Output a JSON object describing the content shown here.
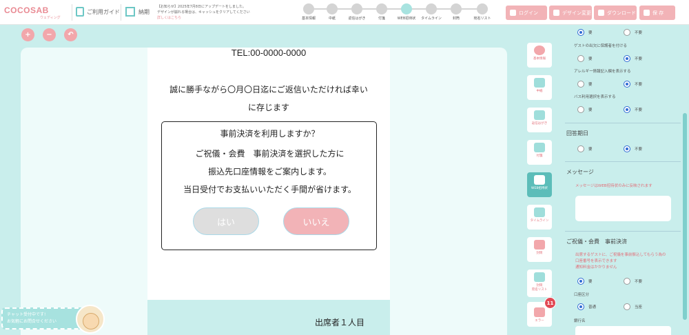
{
  "header": {
    "logo_text": "COCOSAB",
    "logo_sub": "ウェディング",
    "guide_label": "ご利用ガイド",
    "deadline_label": "納期",
    "notice_line1": "【お知らせ】2025年7月8日にアップデートをしました。",
    "notice_line2": "デザインが崩れる場合は、キャッシュをクリアしてください",
    "notice_link": "詳しくはこちら",
    "steps": [
      "基本情報",
      "中紙",
      "返信はがき",
      "付箋",
      "WEB招待状",
      "タイムライン",
      "封筒",
      "宛名リスト"
    ],
    "active_step_index": 4,
    "buttons": {
      "login": "ログイン",
      "change_design": "デザイン変更",
      "download": "ダウンロード",
      "save": "保 存"
    }
  },
  "tools": {
    "zoom_in": "+",
    "zoom_out": "−",
    "back": "↶"
  },
  "card": {
    "tel": "TEL:00-0000-0000",
    "message_line1": "誠に勝手ながら〇月〇日迄にご返信いただければ幸い",
    "message_line2": "に存じます",
    "question": "事前決済を利用しますか？",
    "info_line1": "ご祝儀・会費　事前決済を選択した方に",
    "info_line2": "振込先口座情報をご案内します。",
    "info_line3": "当日受付でお支払いいただく手間が省けます。",
    "yes_label": "はい",
    "no_label": "いいえ",
    "attendees_label": "出席者１人目"
  },
  "chat": {
    "line1": "チャット受付中です!",
    "line2": "お気軽にお問合せください"
  },
  "right_nav": {
    "items": [
      "基本情報",
      "中紙",
      "返信はがき",
      "付箋",
      "WEB招待状",
      "タイムライン",
      "封筒",
      "封筒\n宛名リスト",
      "エラー"
    ],
    "active_index": 4,
    "error_count": "11"
  },
  "panel": {
    "opt_yes": "要",
    "opt_no": "不要",
    "row1": {
      "selected": "yes"
    },
    "guest_parent_label": "ゲストの出欠に保護者を付ける",
    "row2": {
      "selected": "no"
    },
    "allergy_label": "アレルギー情報記入欄を表示する",
    "row3": {
      "selected": "no"
    },
    "bus_label": "バス利用選択を表示する",
    "row4": {
      "selected": "no"
    },
    "deadline_title": "回答期日",
    "row5": {
      "selected": "no"
    },
    "message_title": "メッセージ",
    "message_note": "メッセージはWEB招待状のみに反映されます",
    "prepay_title": "ご祝儀・会費　事前決済",
    "prepay_note1": "出席するゲストに、ご祝儀を事前振込してもらう為の",
    "prepay_note2": "口座番号を表示できます",
    "prepay_note3": "通知料金はかかりません",
    "row6": {
      "selected": "yes"
    },
    "account_type_label": "口座区分",
    "account_normal": "普通",
    "account_current": "当座",
    "row7": {
      "selected": "normal"
    },
    "bank_label": "銀行名"
  },
  "colors": {
    "accent": "#f2b3b7",
    "teal": "#c9eeec",
    "teal_dark": "#5cbdb9",
    "error": "#e14a55"
  }
}
